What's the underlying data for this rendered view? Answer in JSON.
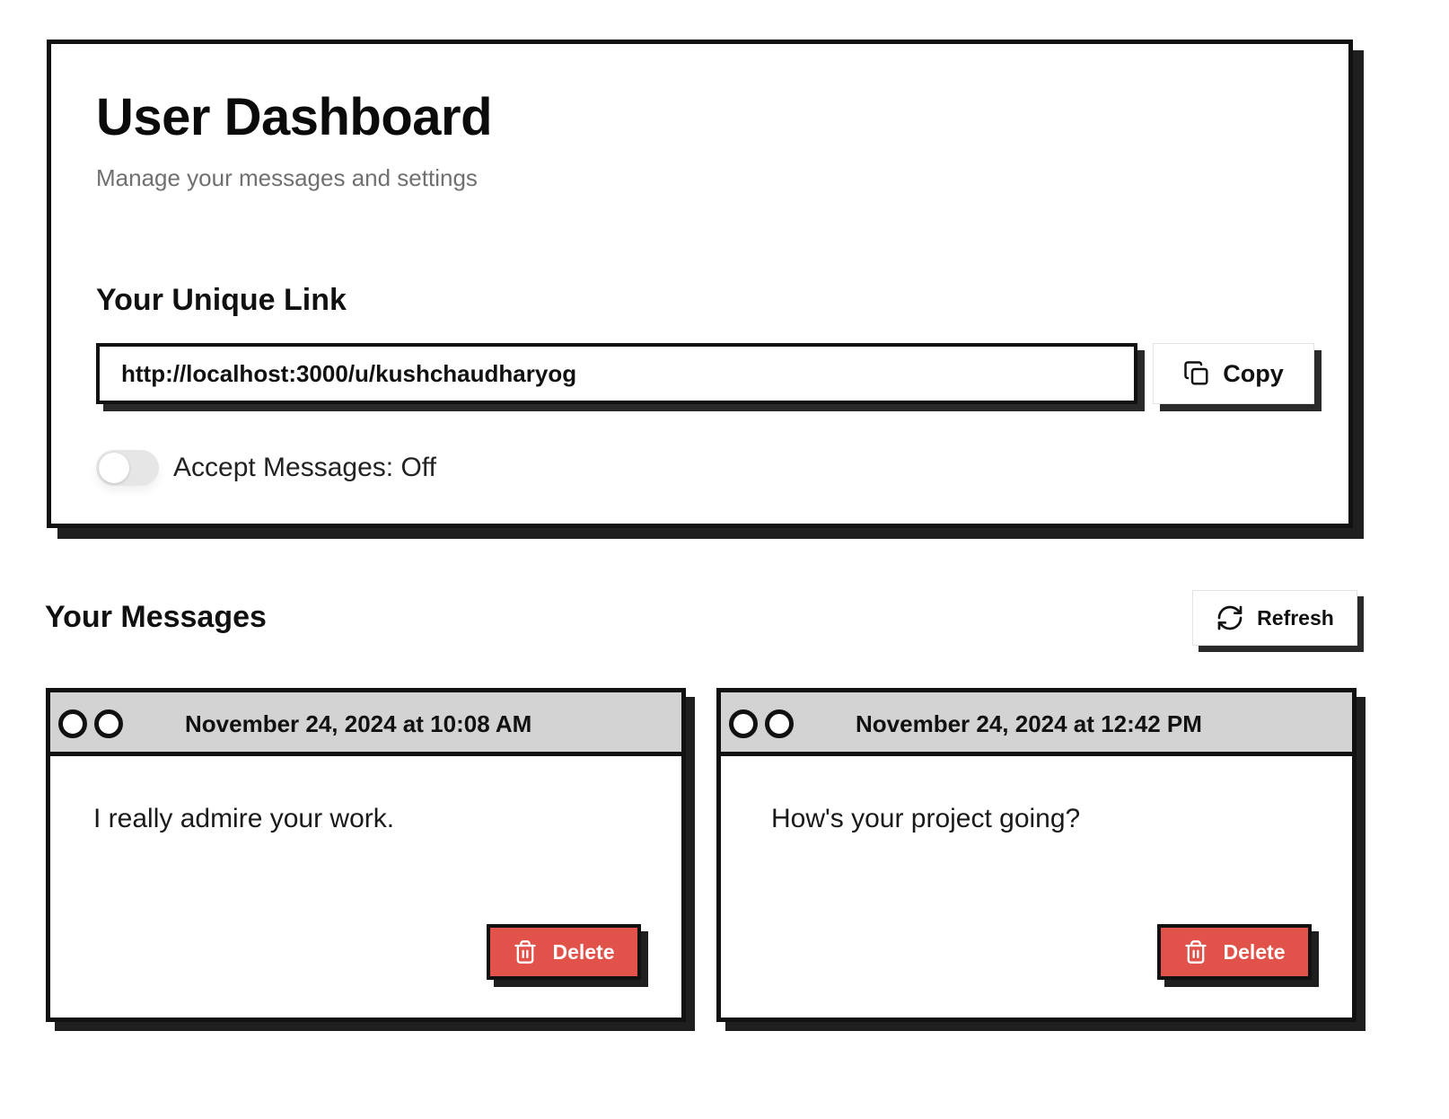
{
  "header": {
    "title": "User Dashboard",
    "subtitle": "Manage your messages and settings"
  },
  "unique_link": {
    "heading": "Your Unique Link",
    "value": "http://localhost:3000/u/kushchaudharyog",
    "copy_label": "Copy",
    "copy_icon": "copy-icon"
  },
  "accept_messages": {
    "label": "Accept Messages: Off",
    "enabled": false
  },
  "messages_section": {
    "heading": "Your Messages",
    "refresh_label": "Refresh",
    "refresh_icon": "refresh-icon"
  },
  "messages": [
    {
      "date": "November 24, 2024 at 10:08 AM",
      "text": "I really admire your work.",
      "delete_label": "Delete"
    },
    {
      "date": "November 24, 2024 at 12:42 PM",
      "text": "How's your project going?",
      "delete_label": "Delete"
    }
  ],
  "colors": {
    "delete": "#e0524a",
    "header_bar": "#d3d3d3",
    "border": "#111111",
    "subtitle": "#707070"
  }
}
